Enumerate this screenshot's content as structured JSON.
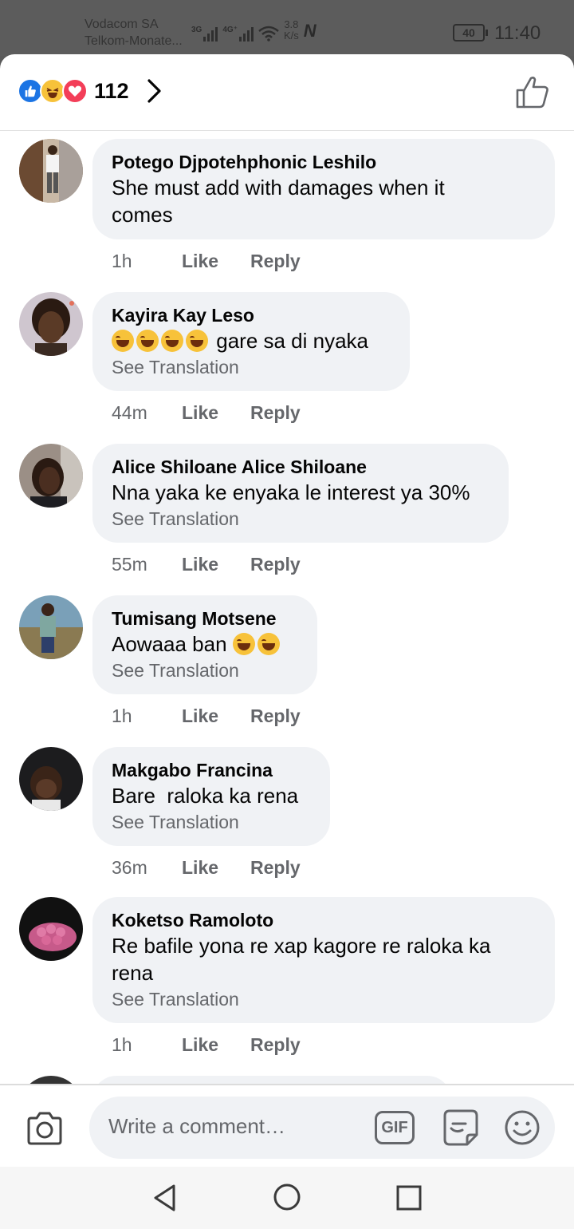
{
  "status_bar": {
    "carrier_1": "Vodacom SA",
    "carrier_2": "Telkom-Monate...",
    "net_1": "3G",
    "net_2": "4G⁺",
    "speed": "3.8",
    "speed_unit": "K/s",
    "battery": "40",
    "time": "11:40"
  },
  "header": {
    "reaction_count": "112",
    "reactions": [
      "like",
      "haha",
      "love"
    ]
  },
  "comments": [
    {
      "name": "Potego Djpotehphonic Leshilo",
      "text_lines": [
        "She must add with damages when it",
        "comes"
      ],
      "translation": "",
      "time": "1h",
      "like": "Like",
      "reply": "Reply"
    },
    {
      "name": "Kayira Kay Leso",
      "emoji_count": 4,
      "text": "gare sa di nyaka",
      "translation": "See Translation",
      "time": "44m",
      "like": "Like",
      "reply": "Reply"
    },
    {
      "name": "Alice Shiloane Alice Shiloane",
      "text": "Nna yaka ke enyaka le interest ya 30%",
      "translation": "See Translation",
      "time": "55m",
      "like": "Like",
      "reply": "Reply"
    },
    {
      "name": "Tumisang Motsene",
      "text": "Aowaaa ban",
      "emoji_count": 2,
      "translation": "See Translation",
      "time": "1h",
      "like": "Like",
      "reply": "Reply"
    },
    {
      "name": "Makgabo Francina",
      "text": "Bare  raloka ka rena",
      "translation": "See Translation",
      "time": "36m",
      "like": "Like",
      "reply": "Reply"
    },
    {
      "name": "Koketso Ramoloto",
      "text_lines": [
        "Re bafile yona re xap kagore re raloka ka",
        "rena"
      ],
      "translation": "See Translation",
      "time": "1h",
      "like": "Like",
      "reply": "Reply"
    }
  ],
  "composer": {
    "placeholder": "Write a comment…",
    "gif_label": "GIF"
  },
  "icons": {
    "camera": "camera-icon",
    "gif": "gif-icon",
    "sticker": "sticker-icon",
    "emoji": "emoji-icon",
    "like_outline": "thumbs-up-icon",
    "chevron": "chevron-right-icon"
  },
  "colors": {
    "like_blue": "#1b74e4",
    "haha_yellow": "#f7c23a",
    "love_red": "#f33e58",
    "bubble_bg": "#f0f2f5",
    "secondary_text": "#65676b"
  }
}
